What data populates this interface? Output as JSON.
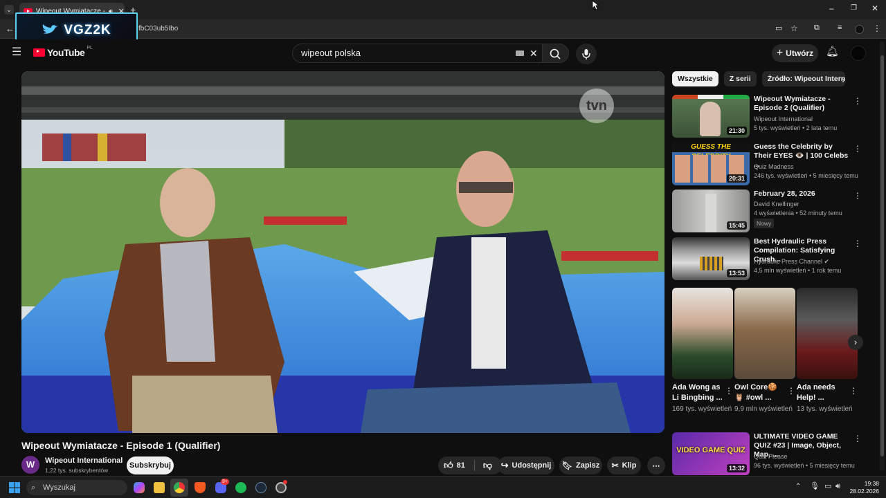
{
  "browser": {
    "tab_title": "Wipeout Wymiatacze - Episode",
    "url": "fbC03ub5Ibo",
    "overlay_logo": "VGZ2K"
  },
  "youtube": {
    "logo_text": "YouTube",
    "logo_region": "PL",
    "search_value": "wipeout polska",
    "create_label": "Utwórz"
  },
  "player": {
    "watermark": "tvn"
  },
  "video": {
    "title": "Wipeout Wymiatacze - Episode 1 (Qualifier)",
    "channel_initial": "W",
    "channel_name": "Wipeout International",
    "subscribers": "1,22 tys. subskrybentów",
    "subscribe_label": "Subskrybuj",
    "likes": "81",
    "share_label": "Udostępnij",
    "save_label": "Zapisz",
    "clip_label": "Klip"
  },
  "chips": [
    "Wszystkie",
    "Z serii",
    "Źródło: Wipeout Internation"
  ],
  "recommendations": [
    {
      "title": "Wipeout Wymiatacze - Episode 2 (Qualifier)",
      "channel": "Wipeout International",
      "meta": "5 tys. wyświetleń • 2 lata temu",
      "duration": "21:30"
    },
    {
      "title": "Guess the Celebrity by Their EYES 👁️ | 100 Celebs ...",
      "channel": "Quiz Madness",
      "meta": "246 tys. wyświetleń • 5 miesięcy temu",
      "duration": "20:31",
      "thumb_text": "GUESS THE CELEBRITY"
    },
    {
      "title": "February 28, 2026",
      "channel": "David Knellinger",
      "meta": "4 wyświetlenia • 52 minuty temu",
      "duration": "15:45",
      "badge": "Nowy"
    },
    {
      "title": "Best Hydraulic Press Compilation: Satisfying Crush...",
      "channel": "Hydraulic Press Channel ✔",
      "meta": "4,5 mln wyświetleń • 1 rok temu",
      "duration": "13:53"
    }
  ],
  "shorts": [
    {
      "title": "Ada Wong as Li Bingbing ...",
      "views": "169 tys. wyświetleń"
    },
    {
      "title": "Owl Core🍪 🦉 #owl ...",
      "views": "9,9 mln wyświetleń"
    },
    {
      "title": "Ada needs Help! ...",
      "views": "13 tys. wyświetleń"
    }
  ],
  "last_rec": {
    "title": "ULTIMATE VIDEO GAME QUIZ #23 | Image, Object, Map, ...",
    "channel": "Quiz Please",
    "meta": "96 tys. wyświetleń • 5 miesięcy temu",
    "duration": "13:32",
    "thumb_text": "VIDEO GAME QUIZ"
  },
  "taskbar": {
    "search_placeholder": "Wyszukaj",
    "time": "19:38",
    "date": "28.02.2026",
    "badge": "9+"
  }
}
